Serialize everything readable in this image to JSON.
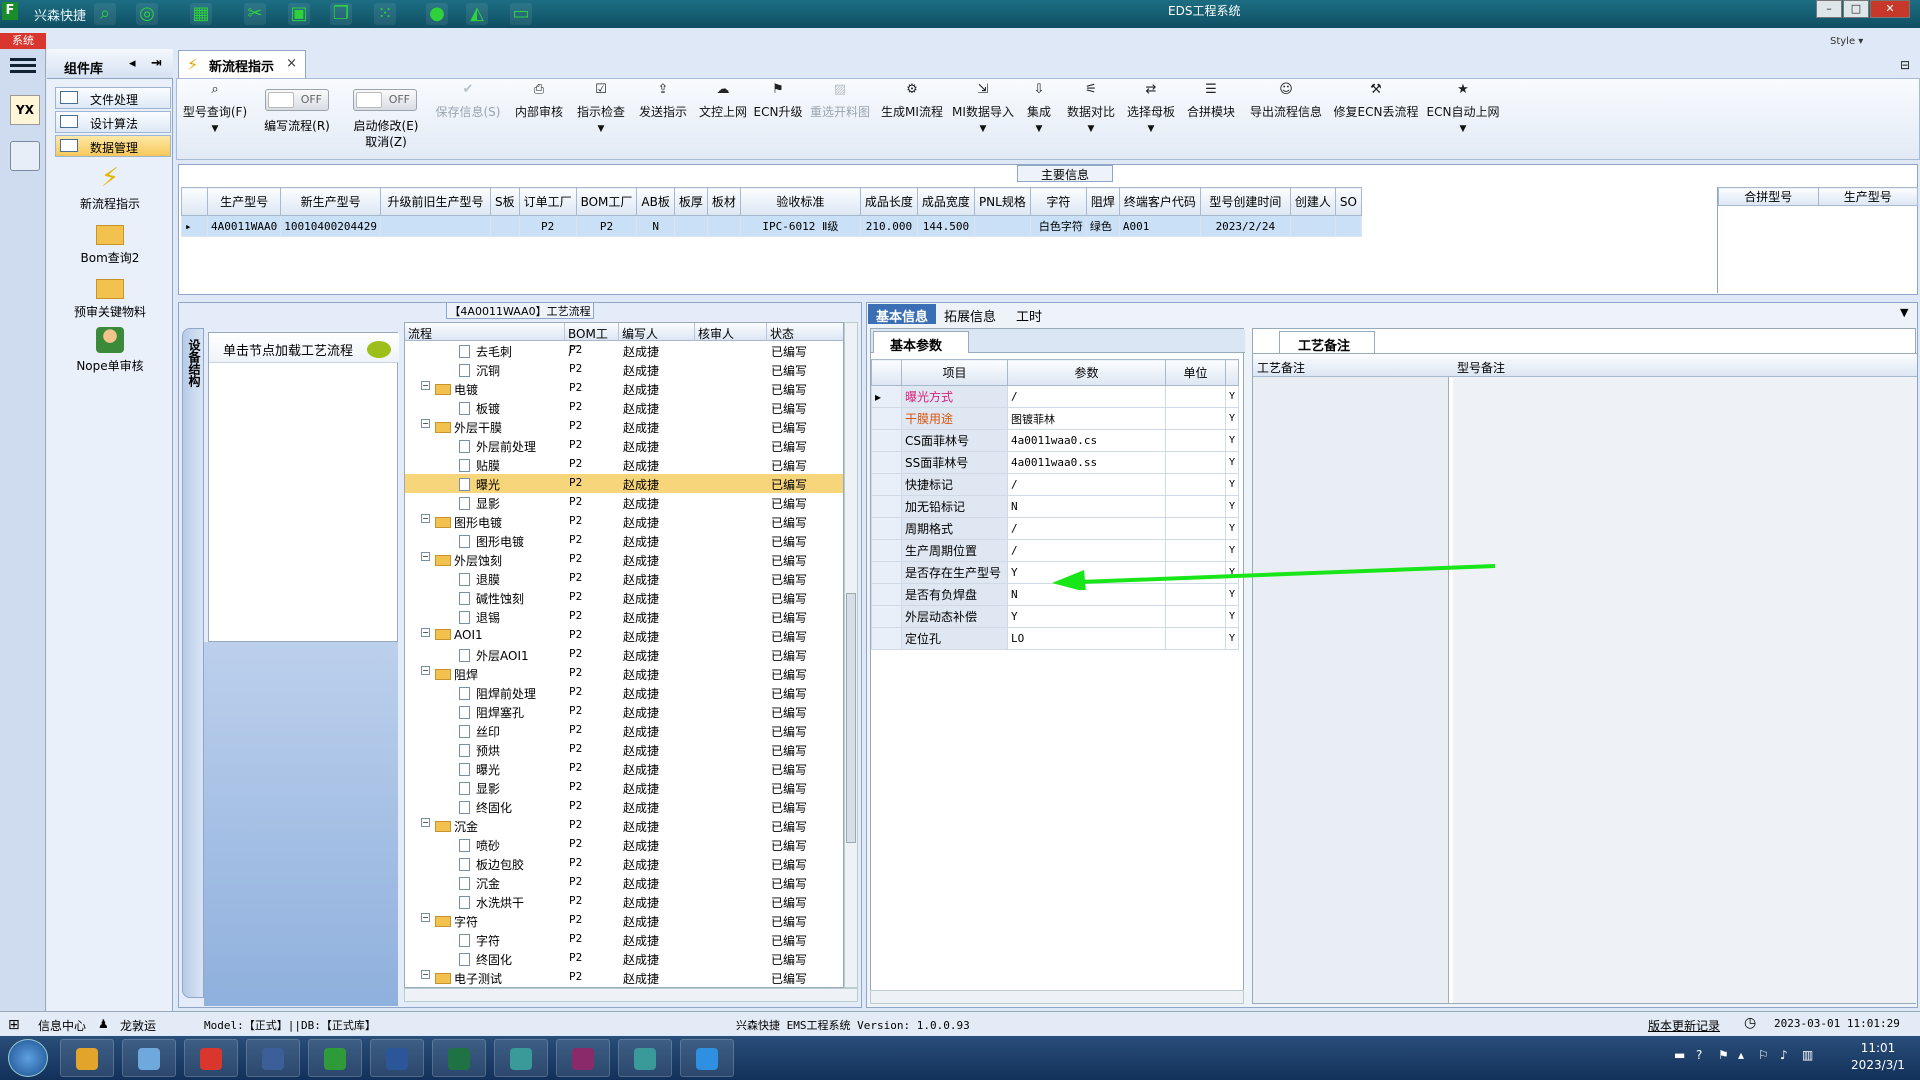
{
  "titlebar": {
    "app_name": "兴森快捷",
    "window_title": "EDS工程系统",
    "style_label": "Style ▾",
    "sys_tab": "系统"
  },
  "nav": {
    "header": "组件库",
    "items": [
      {
        "label": "文件处理"
      },
      {
        "label": "设计算法"
      },
      {
        "label": "数据管理"
      }
    ],
    "tools": [
      {
        "label": "新流程指示"
      },
      {
        "label": "Bom查询2"
      },
      {
        "label": "预审关键物料"
      },
      {
        "label": "Nope单审核"
      }
    ]
  },
  "doctab": {
    "label": "新流程指示",
    "close": "×"
  },
  "ribbon": {
    "query_label": "型号查询(F)",
    "toggle_off": "OFF",
    "write_flow": "编写流程(R)",
    "start_modify": "启动修改(E)",
    "cancel": "取消(Z)",
    "buttons": [
      "保存信息(S)",
      "内部审核",
      "指示检查",
      "发送指示",
      "文控上网",
      "ECN升级",
      "重选开料图",
      "生成MI流程",
      "MI数据导入",
      "集成",
      "数据对比",
      "选择母板",
      "合拼模块",
      "导出流程信息",
      "修复ECN丢流程",
      "ECN自动上网"
    ]
  },
  "maininfo": {
    "caption": "主要信息",
    "columns": [
      "生产型号",
      "新生产型号",
      "升级前旧生产型号",
      "S板",
      "订单工厂",
      "BOM工厂",
      "AB板",
      "板厚",
      "板材",
      "验收标准",
      "成品长度",
      "成品宽度",
      "PNL规格",
      "字符",
      "阻焊",
      "终端客户代码",
      "型号创建时间",
      "创建人",
      "SO"
    ],
    "row": [
      "4A0011WAA0",
      "10010400204429",
      "",
      "",
      "P2",
      "P2",
      "N",
      "",
      "",
      "IPC-6012 Ⅱ级",
      "210.000",
      "144.500",
      "",
      "白色字符",
      "绿色",
      "A001",
      "2023/2/24",
      "",
      ""
    ],
    "side_columns": [
      "合拼型号",
      "生产型号"
    ]
  },
  "process": {
    "caption": "【4A0011WAA0】工艺流程",
    "vtab": "设备结构",
    "hint": "单击节点加载工艺流程",
    "columns": [
      "流程",
      "BOM工厂",
      "编写人",
      "核审人",
      "状态"
    ],
    "rows": [
      {
        "name": "去毛刺",
        "level": 2,
        "folder": false,
        "f": "P2",
        "w": "赵成捷",
        "s": "已编写"
      },
      {
        "name": "沉铜",
        "level": 2,
        "folder": false,
        "f": "P2",
        "w": "赵成捷",
        "s": "已编写"
      },
      {
        "name": "电镀",
        "level": 1,
        "folder": true,
        "f": "P2",
        "w": "赵成捷",
        "s": "已编写"
      },
      {
        "name": "板镀",
        "level": 2,
        "folder": false,
        "f": "P2",
        "w": "赵成捷",
        "s": "已编写"
      },
      {
        "name": "外层干膜",
        "level": 1,
        "folder": true,
        "f": "P2",
        "w": "赵成捷",
        "s": "已编写"
      },
      {
        "name": "外层前处理",
        "level": 2,
        "folder": false,
        "f": "P2",
        "w": "赵成捷",
        "s": "已编写"
      },
      {
        "name": "贴膜",
        "level": 2,
        "folder": false,
        "f": "P2",
        "w": "赵成捷",
        "s": "已编写"
      },
      {
        "name": "曝光",
        "level": 2,
        "folder": false,
        "f": "P2",
        "w": "赵成捷",
        "s": "已编写",
        "sel": true
      },
      {
        "name": "显影",
        "level": 2,
        "folder": false,
        "f": "P2",
        "w": "赵成捷",
        "s": "已编写"
      },
      {
        "name": "图形电镀",
        "level": 1,
        "folder": true,
        "f": "P2",
        "w": "赵成捷",
        "s": "已编写"
      },
      {
        "name": "图形电镀",
        "level": 2,
        "folder": false,
        "f": "P2",
        "w": "赵成捷",
        "s": "已编写"
      },
      {
        "name": "外层蚀刻",
        "level": 1,
        "folder": true,
        "f": "P2",
        "w": "赵成捷",
        "s": "已编写"
      },
      {
        "name": "退膜",
        "level": 2,
        "folder": false,
        "f": "P2",
        "w": "赵成捷",
        "s": "已编写"
      },
      {
        "name": "碱性蚀刻",
        "level": 2,
        "folder": false,
        "f": "P2",
        "w": "赵成捷",
        "s": "已编写"
      },
      {
        "name": "退锡",
        "level": 2,
        "folder": false,
        "f": "P2",
        "w": "赵成捷",
        "s": "已编写"
      },
      {
        "name": "AOI1",
        "level": 1,
        "folder": true,
        "f": "P2",
        "w": "赵成捷",
        "s": "已编写"
      },
      {
        "name": "外层AOI1",
        "level": 2,
        "folder": false,
        "f": "P2",
        "w": "赵成捷",
        "s": "已编写"
      },
      {
        "name": "阻焊",
        "level": 1,
        "folder": true,
        "f": "P2",
        "w": "赵成捷",
        "s": "已编写"
      },
      {
        "name": "阻焊前处理",
        "level": 2,
        "folder": false,
        "f": "P2",
        "w": "赵成捷",
        "s": "已编写"
      },
      {
        "name": "阻焊塞孔",
        "level": 2,
        "folder": false,
        "f": "P2",
        "w": "赵成捷",
        "s": "已编写"
      },
      {
        "name": "丝印",
        "level": 2,
        "folder": false,
        "f": "P2",
        "w": "赵成捷",
        "s": "已编写"
      },
      {
        "name": "预烘",
        "level": 2,
        "folder": false,
        "f": "P2",
        "w": "赵成捷",
        "s": "已编写"
      },
      {
        "name": "曝光",
        "level": 2,
        "folder": false,
        "f": "P2",
        "w": "赵成捷",
        "s": "已编写"
      },
      {
        "name": "显影",
        "level": 2,
        "folder": false,
        "f": "P2",
        "w": "赵成捷",
        "s": "已编写"
      },
      {
        "name": "终固化",
        "level": 2,
        "folder": false,
        "f": "P2",
        "w": "赵成捷",
        "s": "已编写"
      },
      {
        "name": "沉金",
        "level": 1,
        "folder": true,
        "f": "P2",
        "w": "赵成捷",
        "s": "已编写"
      },
      {
        "name": "喷砂",
        "level": 2,
        "folder": false,
        "f": "P2",
        "w": "赵成捷",
        "s": "已编写"
      },
      {
        "name": "板边包胶",
        "level": 2,
        "folder": false,
        "f": "P2",
        "w": "赵成捷",
        "s": "已编写"
      },
      {
        "name": "沉金",
        "level": 2,
        "folder": false,
        "f": "P2",
        "w": "赵成捷",
        "s": "已编写"
      },
      {
        "name": "水洗烘干",
        "level": 2,
        "folder": false,
        "f": "P2",
        "w": "赵成捷",
        "s": "已编写"
      },
      {
        "name": "字符",
        "level": 1,
        "folder": true,
        "f": "P2",
        "w": "赵成捷",
        "s": "已编写"
      },
      {
        "name": "字符",
        "level": 2,
        "folder": false,
        "f": "P2",
        "w": "赵成捷",
        "s": "已编写"
      },
      {
        "name": "终固化",
        "level": 2,
        "folder": false,
        "f": "P2",
        "w": "赵成捷",
        "s": "已编写"
      },
      {
        "name": "电子测试",
        "level": 1,
        "folder": true,
        "f": "P2",
        "w": "赵成捷",
        "s": "已编写"
      }
    ]
  },
  "info": {
    "tabs": [
      "基本信息",
      "拓展信息",
      "工时"
    ],
    "basic_title": "基本参数",
    "param_columns": [
      "项目",
      "参数",
      "单位"
    ],
    "params": [
      {
        "k": "曝光方式",
        "v": "/",
        "y": "Y",
        "style": "pink"
      },
      {
        "k": "干膜用途",
        "v": "图镀菲林",
        "y": "Y",
        "style": "org"
      },
      {
        "k": "CS面菲林号",
        "v": "4a0011waa0.cs",
        "y": "Y",
        "style": ""
      },
      {
        "k": "SS面菲林号",
        "v": "4a0011waa0.ss",
        "y": "Y",
        "style": ""
      },
      {
        "k": "快捷标记",
        "v": "/",
        "y": "Y",
        "style": ""
      },
      {
        "k": "加无铅标记",
        "v": "N",
        "y": "Y",
        "style": ""
      },
      {
        "k": "周期格式",
        "v": "/",
        "y": "Y",
        "style": ""
      },
      {
        "k": "生产周期位置",
        "v": "/",
        "y": "Y",
        "style": ""
      },
      {
        "k": "是否存在生产型号",
        "v": "Y",
        "y": "Y",
        "style": ""
      },
      {
        "k": "是否有负焊盘",
        "v": "N",
        "y": "Y",
        "style": ""
      },
      {
        "k": "外层动态补偿",
        "v": "Y",
        "y": "Y",
        "style": ""
      },
      {
        "k": "定位孔",
        "v": "LO",
        "y": "Y",
        "style": ""
      }
    ],
    "notes_title": "工艺备注",
    "note_columns": [
      "工艺备注",
      "型号备注"
    ]
  },
  "status": {
    "info_center": "信息中心",
    "user": "龙敦运",
    "model": "Model:【正式】||DB:【正式库】",
    "version": "兴森快捷 EMS工程系统 Version: 1.0.0.93",
    "update_log": "版本更新记录",
    "datetime": "2023-03-01 11:01:29"
  },
  "taskbar": {
    "time": "11:01",
    "date": "2023/3/1"
  },
  "colors": {
    "selection": "#f7d57b",
    "arrow": "#19e619",
    "title_bar": "#1d6e83"
  }
}
